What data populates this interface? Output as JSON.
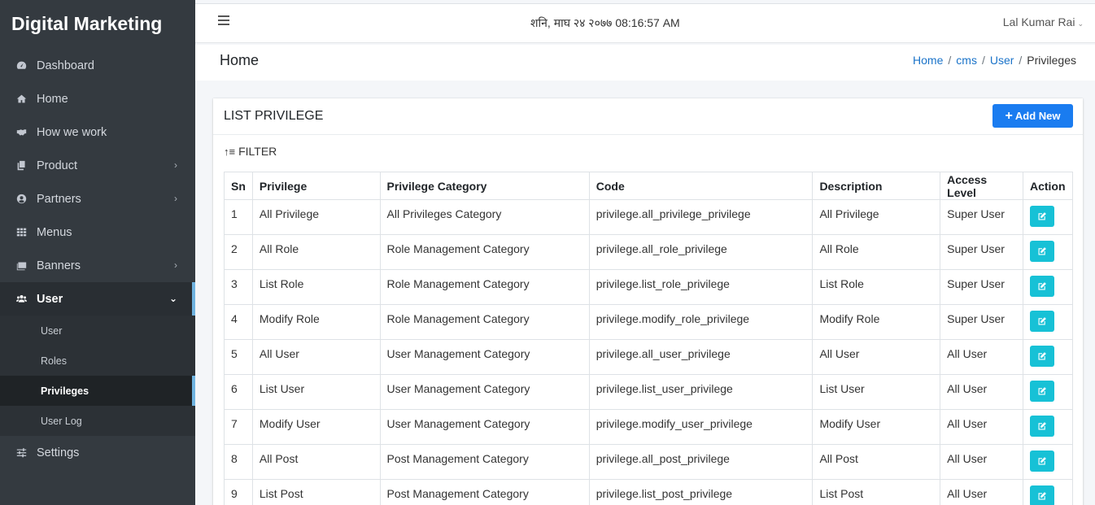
{
  "brand": "Digital Marketing",
  "sidebar": {
    "items": [
      {
        "label": "Dashboard",
        "icon": "dashboard-icon"
      },
      {
        "label": "Home",
        "icon": "home-icon"
      },
      {
        "label": "How we work",
        "icon": "handshake-icon"
      },
      {
        "label": "Product",
        "icon": "copy-icon"
      },
      {
        "label": "Partners",
        "icon": "user-circle-icon"
      },
      {
        "label": "Menus",
        "icon": "grid-icon"
      },
      {
        "label": "Banners",
        "icon": "images-icon"
      },
      {
        "label": "User",
        "icon": "users-icon"
      },
      {
        "label": "Settings",
        "icon": "sliders-icon"
      }
    ],
    "user_sub": [
      "User",
      "Roles",
      "Privileges",
      "User Log"
    ]
  },
  "topbar": {
    "datetime": "शनि, माघ २४ २०७७ 08:16:57 AM",
    "user": "Lal Kumar Rai"
  },
  "header": {
    "title": "Home",
    "breadcrumb": [
      "Home",
      "cms",
      "User",
      "Privileges"
    ]
  },
  "card": {
    "title": "LIST PRIVILEGE",
    "add_label": "Add New",
    "filter_label": "FILTER"
  },
  "table": {
    "columns": [
      "Sn",
      "Privilege",
      "Privilege Category",
      "Code",
      "Description",
      "Access Level",
      "Action"
    ],
    "rows": [
      [
        "1",
        "All Privilege",
        "All Privileges Category",
        "privilege.all_privilege_privilege",
        "All Privilege",
        "Super User"
      ],
      [
        "2",
        "All Role",
        "Role Management Category",
        "privilege.all_role_privilege",
        "All Role",
        "Super User"
      ],
      [
        "3",
        "List Role",
        "Role Management Category",
        "privilege.list_role_privilege",
        "List Role",
        "Super User"
      ],
      [
        "4",
        "Modify Role",
        "Role Management Category",
        "privilege.modify_role_privilege",
        "Modify Role",
        "Super User"
      ],
      [
        "5",
        "All User",
        "User Management Category",
        "privilege.all_user_privilege",
        "All User",
        "All User"
      ],
      [
        "6",
        "List User",
        "User Management Category",
        "privilege.list_user_privilege",
        "List User",
        "All User"
      ],
      [
        "7",
        "Modify User",
        "User Management Category",
        "privilege.modify_user_privilege",
        "Modify User",
        "All User"
      ],
      [
        "8",
        "All Post",
        "Post Management Category",
        "privilege.all_post_privilege",
        "All Post",
        "All User"
      ],
      [
        "9",
        "List Post",
        "Post Management Category",
        "privilege.list_post_privilege",
        "List Post",
        "All User"
      ]
    ]
  },
  "colors": {
    "sidebar_bg": "#343a40",
    "primary": "#1a7cf0",
    "edit_button": "#17c1d6",
    "link": "#1a73c9"
  }
}
